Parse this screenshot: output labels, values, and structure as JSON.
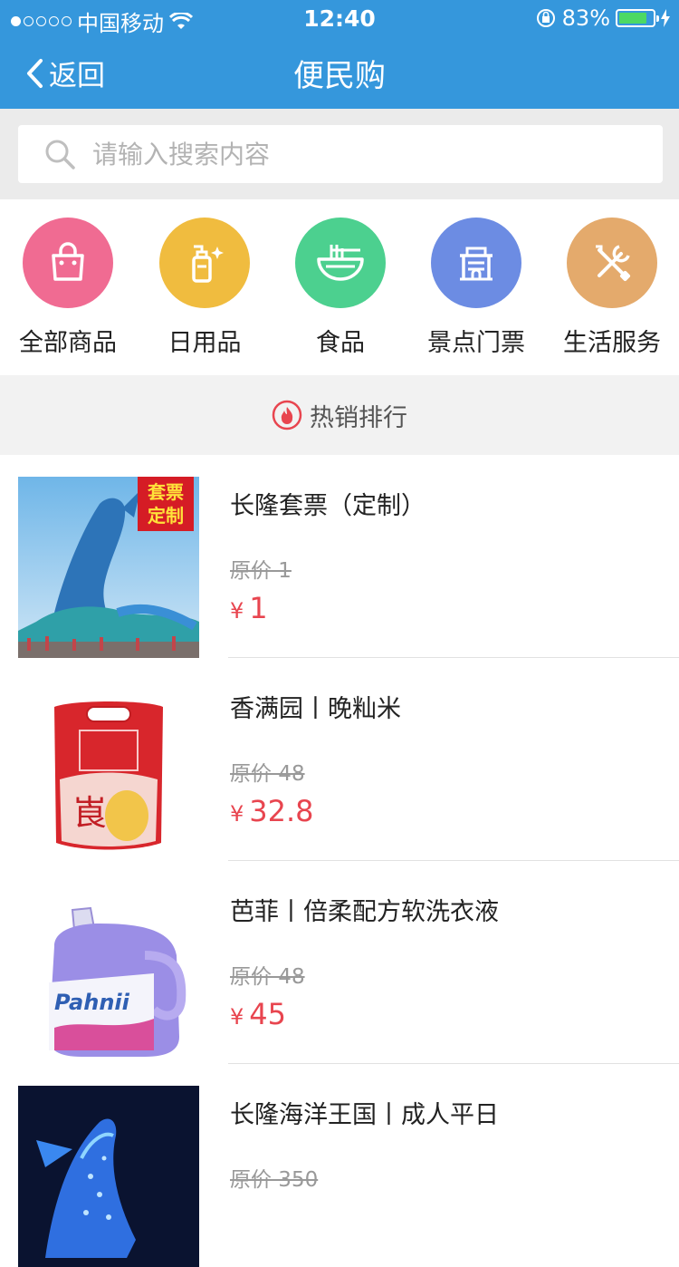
{
  "status_bar": {
    "carrier": "中国移动",
    "time": "12:40",
    "battery": "83%",
    "battery_level": 0.83
  },
  "nav": {
    "back_label": "返回",
    "title": "便民购"
  },
  "search": {
    "placeholder": "请输入搜索内容"
  },
  "categories": [
    {
      "label": "全部商品",
      "icon": "shopping-bag-icon",
      "color": "#f06b92"
    },
    {
      "label": "日用品",
      "icon": "spray-bottle-icon",
      "color": "#f0bc3f"
    },
    {
      "label": "食品",
      "icon": "noodle-bowl-icon",
      "color": "#4cd08f"
    },
    {
      "label": "景点门票",
      "icon": "ticket-gate-icon",
      "color": "#6c8ce3"
    },
    {
      "label": "生活服务",
      "icon": "tools-icon",
      "color": "#e4aa6c"
    }
  ],
  "hot_section": {
    "label": "热销排行",
    "icon": "flame-icon",
    "color": "#e8454f"
  },
  "products": [
    {
      "name": "长隆套票（定制）",
      "original_price": "原价 1",
      "currency": "¥",
      "price": "1",
      "badge": "套票\n定制",
      "image": "whale-shark-sculpture"
    },
    {
      "name": "香满园丨晚籼米",
      "original_price": "原价 48",
      "currency": "¥",
      "price": "32.8",
      "image": "rice-bag"
    },
    {
      "name": "芭菲丨倍柔配方软洗衣液",
      "original_price": "原价 48",
      "currency": "¥",
      "price": "45",
      "image": "detergent-bottle"
    },
    {
      "name": "长隆海洋王国丨成人平日",
      "original_price": "原价 350",
      "currency": "¥",
      "price": "",
      "image": "glowing-whale-shark"
    }
  ]
}
